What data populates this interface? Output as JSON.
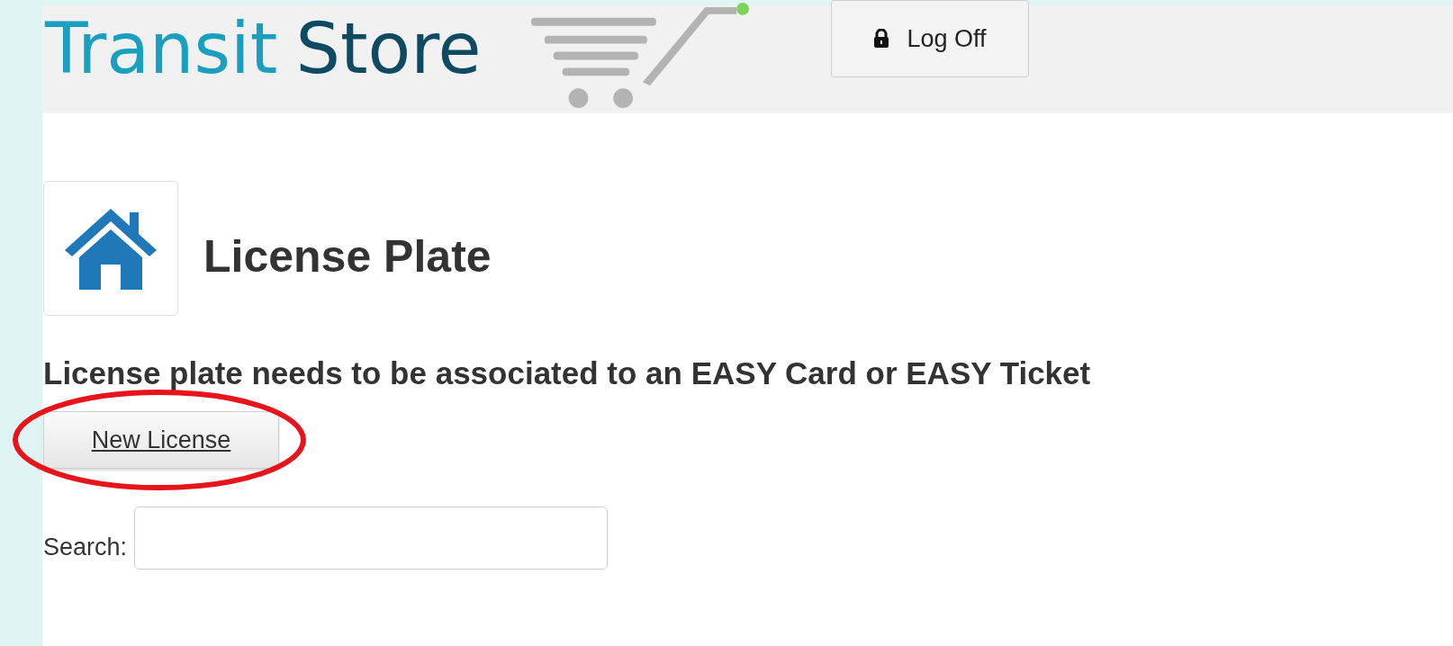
{
  "header": {
    "logo": {
      "part_1": "Transit",
      "part_2": "Store"
    },
    "log_off_button": {
      "label": "Log Off"
    }
  },
  "page": {
    "title": "License Plate",
    "notice": "License plate needs to be associated to an EASY Card or EASY Ticket",
    "new_button": {
      "label": "New License"
    },
    "search": {
      "label": "Search:"
    }
  }
}
